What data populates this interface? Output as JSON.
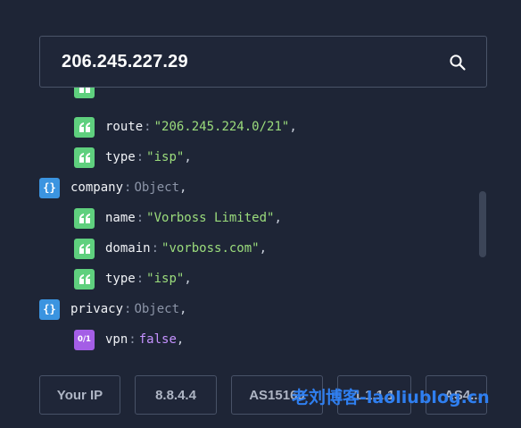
{
  "search": {
    "value": "206.245.227.29"
  },
  "icons": {
    "search": "search-icon",
    "string": "quote-icon",
    "object": "braces-icon",
    "boolean": "boolean-icon"
  },
  "json_view": {
    "rows": [
      {
        "type": "string",
        "key": "route",
        "value": "\"206.245.224.0/21\"",
        "comma": ","
      },
      {
        "type": "string",
        "key": "type",
        "value": "\"isp\"",
        "comma": ","
      },
      {
        "type": "object",
        "key": "company",
        "value": "Object",
        "comma": ","
      },
      {
        "type": "string",
        "key": "name",
        "value": "\"Vorboss Limited\"",
        "comma": ","
      },
      {
        "type": "string",
        "key": "domain",
        "value": "\"vorboss.com\"",
        "comma": ","
      },
      {
        "type": "string",
        "key": "type",
        "value": "\"isp\"",
        "comma": ","
      },
      {
        "type": "object",
        "key": "privacy",
        "value": "Object",
        "comma": ","
      },
      {
        "type": "boolean",
        "key": "vpn",
        "value": "false",
        "comma": ","
      }
    ],
    "object_badge": "{}",
    "boolean_badge": "0/1",
    "colon": ":"
  },
  "quick_links": [
    {
      "label": "Your IP"
    },
    {
      "label": "8.8.4.4"
    },
    {
      "label": "AS15169"
    },
    {
      "label": "1.1.1.1"
    },
    {
      "label": "AS4..."
    }
  ],
  "watermark": "老刘博客-laoliublog.cn",
  "colors": {
    "background": "#1e2536",
    "string_badge": "#5fd07e",
    "object_badge": "#3b94e0",
    "boolean_badge": "#a45ee6",
    "string_value": "#9bdc7c",
    "boolean_value": "#c592ff",
    "watermark": "#2f7ff0"
  }
}
